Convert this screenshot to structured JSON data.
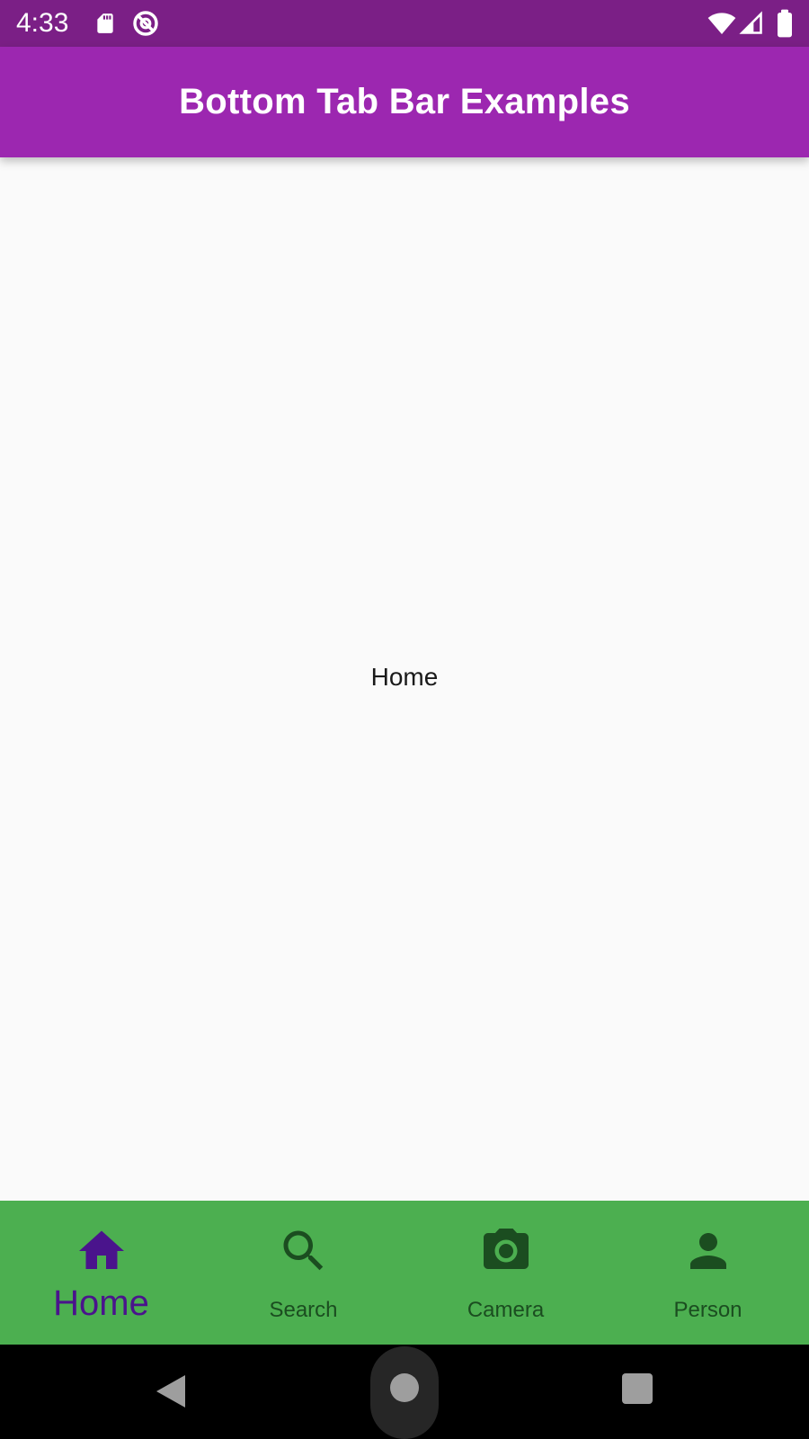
{
  "status_bar": {
    "time": "4:33",
    "icons": [
      "sd-card-icon",
      "sync-icon",
      "wifi-icon",
      "signal-icon",
      "battery-icon"
    ],
    "color": "#7b1f86"
  },
  "app_bar": {
    "title": "Bottom Tab Bar Examples",
    "color": "#9c27b0"
  },
  "content": {
    "text": "Home"
  },
  "tab_bar": {
    "color": "#4caf50",
    "active_color": "#4a148c",
    "inactive_color": "#1b4d20",
    "tabs": [
      {
        "label": "Home",
        "icon": "home-icon",
        "active": true
      },
      {
        "label": "Search",
        "icon": "search-icon",
        "active": false
      },
      {
        "label": "Camera",
        "icon": "camera-icon",
        "active": false
      },
      {
        "label": "Person",
        "icon": "person-icon",
        "active": false
      }
    ]
  },
  "nav_bar": {
    "buttons": [
      "back-icon",
      "home-icon",
      "recents-icon"
    ]
  }
}
